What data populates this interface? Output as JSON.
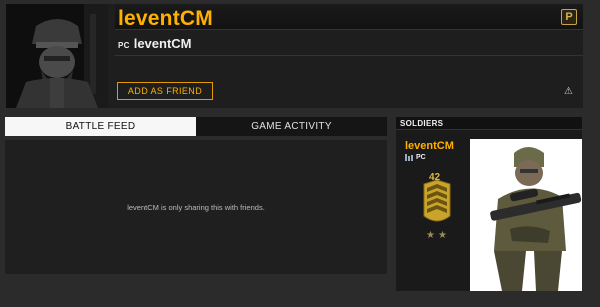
{
  "profile": {
    "username": "leventCM",
    "platform_tag": "PC",
    "platform_name": "leventCM",
    "add_friend_label": "ADD AS FRIEND",
    "premium_icon": "premium-p-icon",
    "report_icon": "warning-triangle-icon"
  },
  "tabs": [
    {
      "label": "BATTLE FEED",
      "active": true
    },
    {
      "label": "GAME ACTIVITY",
      "active": false
    }
  ],
  "feed": {
    "message": "leventCM is only sharing this with friends."
  },
  "soldiers": {
    "title": "SOLDIERS",
    "name": "leventCM",
    "platform": "PC",
    "rank": "42"
  },
  "colors": {
    "accent": "#ffb000",
    "background": "#2b2b2b",
    "panel": "#1f1f1f"
  }
}
